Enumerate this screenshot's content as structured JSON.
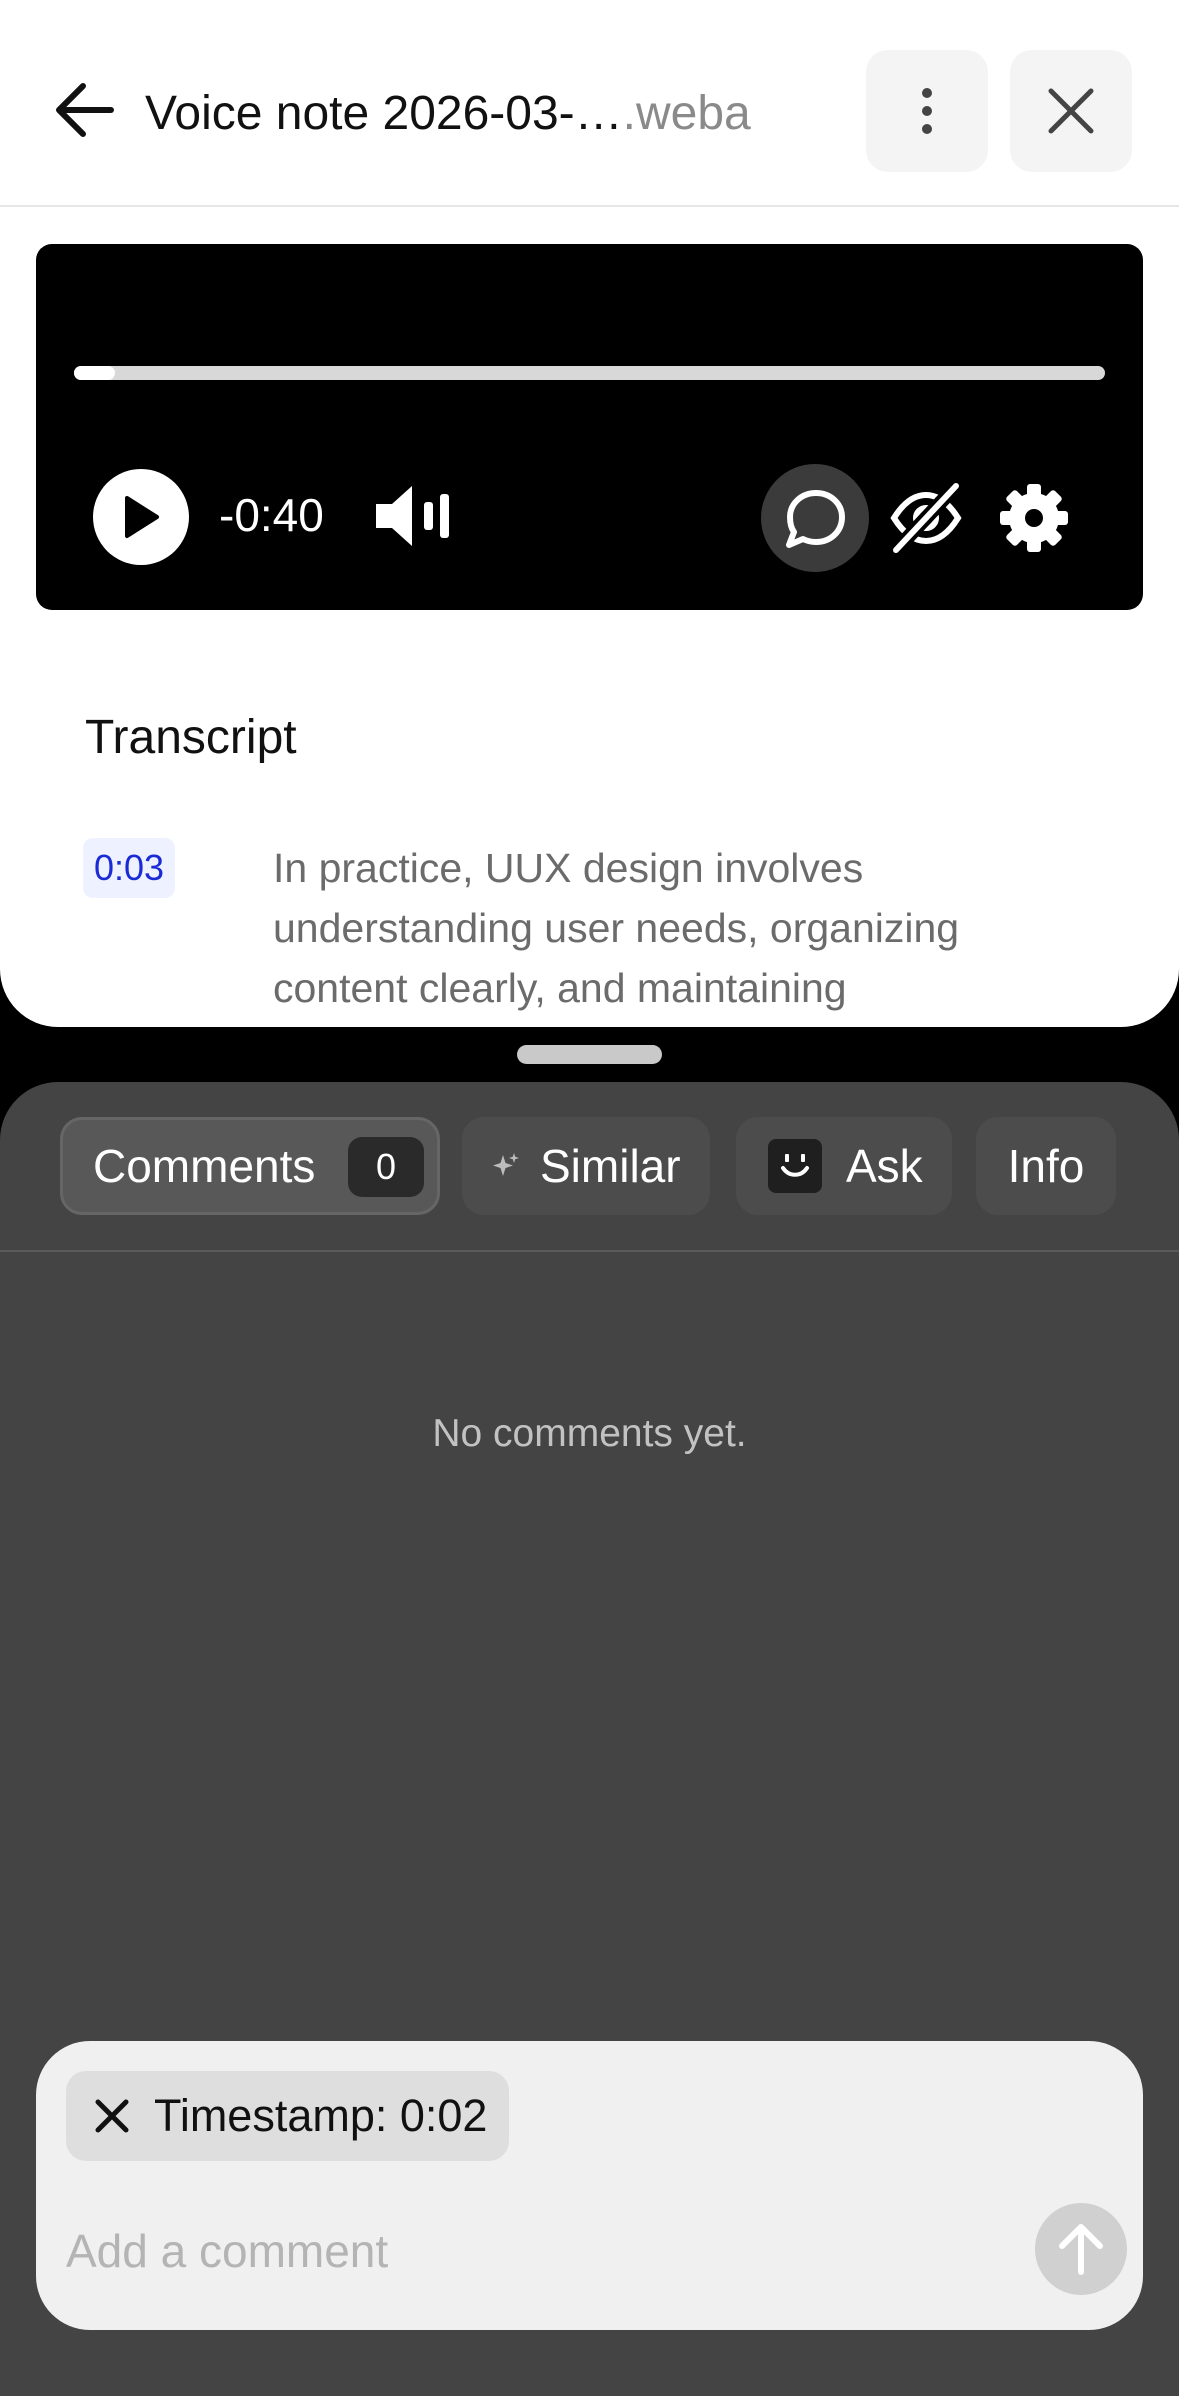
{
  "header": {
    "title_name": "Voice note 2026-03-…",
    "title_ext": ".weba",
    "back_icon": "arrow-left-icon",
    "more_icon": "more-vertical-icon",
    "close_icon": "close-icon"
  },
  "player": {
    "progress_fraction": 0.04,
    "time_remaining": "-0:40",
    "controls": [
      "play-icon",
      "volume-icon",
      "comment-bubble-icon",
      "eye-off-icon",
      "gear-icon"
    ]
  },
  "transcript": {
    "heading": "Transcript",
    "segments": [
      {
        "timestamp": "0:03",
        "text": "In practice, UUX design involves understanding user needs, organizing content clearly, and maintaining"
      }
    ]
  },
  "panel": {
    "tabs": [
      {
        "label": "Comments",
        "count": "0",
        "active": true
      },
      {
        "label": "Similar",
        "icon": "sparkle-icon"
      },
      {
        "label": "Ask",
        "icon": "smiley-icon"
      },
      {
        "label": "Info"
      }
    ],
    "empty_message": "No comments yet."
  },
  "composer": {
    "chip_label": "Timestamp: 0:02",
    "placeholder": "Add a comment",
    "value": ""
  },
  "colors": {
    "panel_bg": "#444444",
    "timestamp_accent": "#1a2bd6",
    "timestamp_bg": "#eef1ff"
  }
}
